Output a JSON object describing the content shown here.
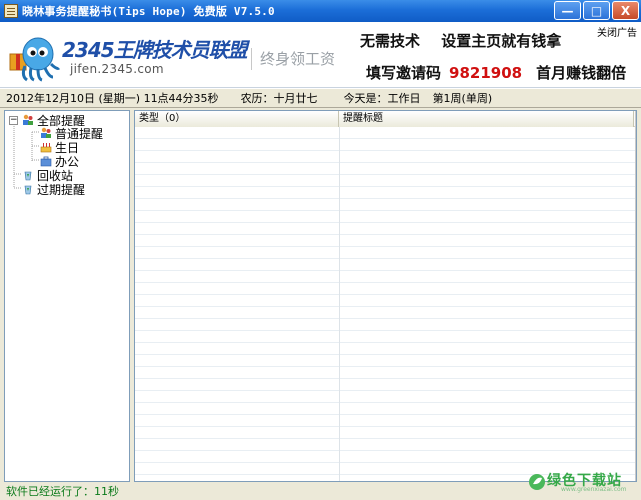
{
  "window": {
    "title": "晓林事务提醒秘书(Tips Hope) 免费版 V7.5.0",
    "buttons": {
      "minimize": "—",
      "maximize": "□",
      "close": "X"
    }
  },
  "banner": {
    "logo_text": "2345王牌技术员联盟",
    "logo_url": "jifen.2345.com",
    "slogan": "终身领工资",
    "close_ad": "关闭广告",
    "ad_line1": [
      "无需技术",
      "设置主页就有钱拿"
    ],
    "ad_line2_prefix": "填写邀请码",
    "ad_line2_code": "9821908",
    "ad_line2_suffix": "首月赚钱翻倍"
  },
  "infobar": {
    "date": "2012年12月10日 (星期一) 11点44分35秒",
    "lunar": "农历：十月廿七",
    "today": "今天是：工作日",
    "week": "第1周(单周)"
  },
  "tree": {
    "expander": "−",
    "items": [
      {
        "label": "全部提醒",
        "level": 0,
        "icon": "people-icon"
      },
      {
        "label": "普通提醒",
        "level": 1,
        "icon": "people-icon"
      },
      {
        "label": "生日",
        "level": 1,
        "icon": "cake-icon"
      },
      {
        "label": "办公",
        "level": 1,
        "icon": "briefcase-icon"
      },
      {
        "label": "回收站",
        "level": 0,
        "icon": "recycle-icon"
      },
      {
        "label": "过期提醒",
        "level": 0,
        "icon": "recycle-icon"
      }
    ]
  },
  "listview": {
    "columns": [
      "类型（0）",
      "提醒标题"
    ]
  },
  "statusbar": {
    "text": "软件已经运行了：11秒"
  },
  "watermark": {
    "text": "绿色下载站",
    "url": "www.greenxiazai.com"
  },
  "colors": {
    "titlebar": "#1c6ed8",
    "accent_code": "#d01010",
    "status_text": "#0a7a1a",
    "logo_blue": "#1f4fa8"
  }
}
